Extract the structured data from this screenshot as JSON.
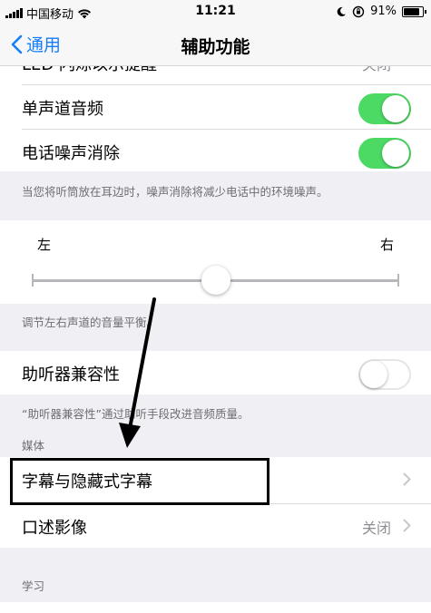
{
  "status_bar": {
    "carrier": "中国移动",
    "time": "11:21",
    "battery": "91%",
    "battery_level": 0.91
  },
  "nav": {
    "back_label": "通用",
    "title": "辅助功能"
  },
  "rows": {
    "partial_top_label": "LED 闪烁以示提醒",
    "partial_top_value": "关闭",
    "mono_audio": {
      "label": "单声道音频",
      "on": true
    },
    "noise_cancel": {
      "label": "电话噪声消除",
      "on": true
    },
    "noise_cancel_footnote": "当您将听筒放在耳边时，噪声消除将减少电话中的环境噪声。",
    "balance": {
      "left": "左",
      "right": "右",
      "value": 0.5
    },
    "balance_footnote": "调节左右声道的音量平衡。",
    "hearing_aid": {
      "label": "助听器兼容性",
      "on": false
    },
    "hearing_aid_footnote": "“助听器兼容性”通过助听手段改进音频质量。",
    "media_header": "媒体",
    "subtitles": {
      "label": "字幕与隐藏式字幕"
    },
    "audio_desc": {
      "label": "口述影像",
      "value": "关闭"
    },
    "learning_header": "学习"
  },
  "colors": {
    "accent": "#147efb",
    "toggle_on": "#4cd964",
    "annotation": "#000000"
  }
}
